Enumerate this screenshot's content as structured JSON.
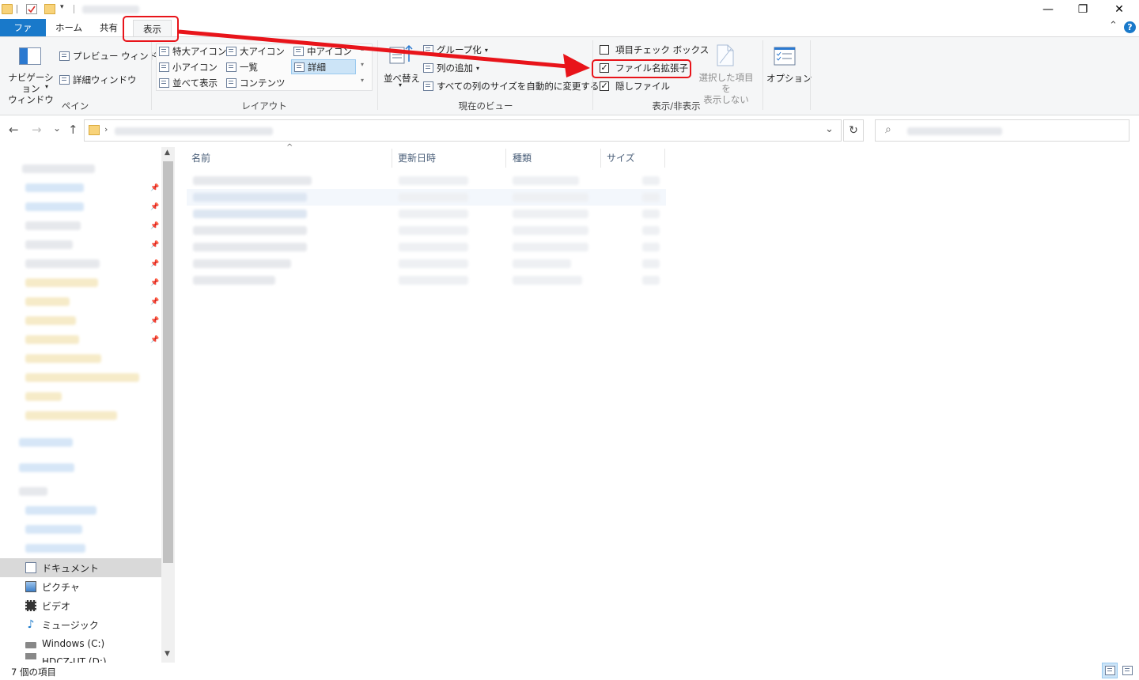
{
  "window": {
    "title_blurred": "",
    "minimize_glyph": "—",
    "restore_glyph": "❐",
    "close_glyph": "✕"
  },
  "tabs": {
    "file": "ファイル",
    "home": "ホーム",
    "share": "共有",
    "view": "表示",
    "help_glyph": "?",
    "collapse_glyph": "⌃"
  },
  "ribbon": {
    "pane": {
      "label": "ペイン",
      "nav_pane": "ナビゲーション\nウィンドウ",
      "preview_pane": "プレビュー ウィンドウ",
      "details_pane": "詳細ウィンドウ"
    },
    "layout": {
      "label": "レイアウト",
      "items": [
        "特大アイコン",
        "大アイコン",
        "中アイコン",
        "小アイコン",
        "一覧",
        "詳細",
        "並べて表示",
        "コンテンツ"
      ]
    },
    "current_view": {
      "label": "現在のビュー",
      "sort_by": "並べ替え",
      "group_by": "グループ化",
      "add_columns": "列の追加",
      "size_all_columns": "すべての列のサイズを自動的に変更する"
    },
    "show_hide": {
      "label": "表示/非表示",
      "item_check_boxes": "項目チェック ボックス",
      "file_name_extensions": "ファイル名拡張子",
      "hidden_items": "隠しファイル",
      "hide_selected": "選択した項目を\n表示しない",
      "check_states": {
        "item_check_boxes": false,
        "file_name_extensions": true,
        "hidden_items": true
      }
    },
    "options": "オプション"
  },
  "address": {
    "back": "←",
    "forward": "→",
    "recent": "⌄",
    "up": "↑",
    "refresh": "↻",
    "dropdown": "⌄",
    "search_glyph": "⌕"
  },
  "navpane": {
    "items": [
      {
        "label": "ドキュメント",
        "icon": "documents-icon",
        "selected": true
      },
      {
        "label": "ピクチャ",
        "icon": "pictures-icon",
        "selected": false
      },
      {
        "label": "ビデオ",
        "icon": "videos-icon",
        "selected": false
      },
      {
        "label": "ミュージック",
        "icon": "music-icon",
        "selected": false
      },
      {
        "label": "Windows (C:)",
        "icon": "drive-icon",
        "selected": false
      },
      {
        "label": "HDCZ-UT (D:)",
        "icon": "drive-icon",
        "selected": false
      }
    ]
  },
  "filelist": {
    "columns": [
      "名前",
      "更新日時",
      "種類",
      "サイズ"
    ],
    "sort_glyph": "^"
  },
  "status": {
    "item_count": "7 個の項目"
  },
  "colors": {
    "accent": "#1979ca",
    "annotation": "#e8141a"
  }
}
